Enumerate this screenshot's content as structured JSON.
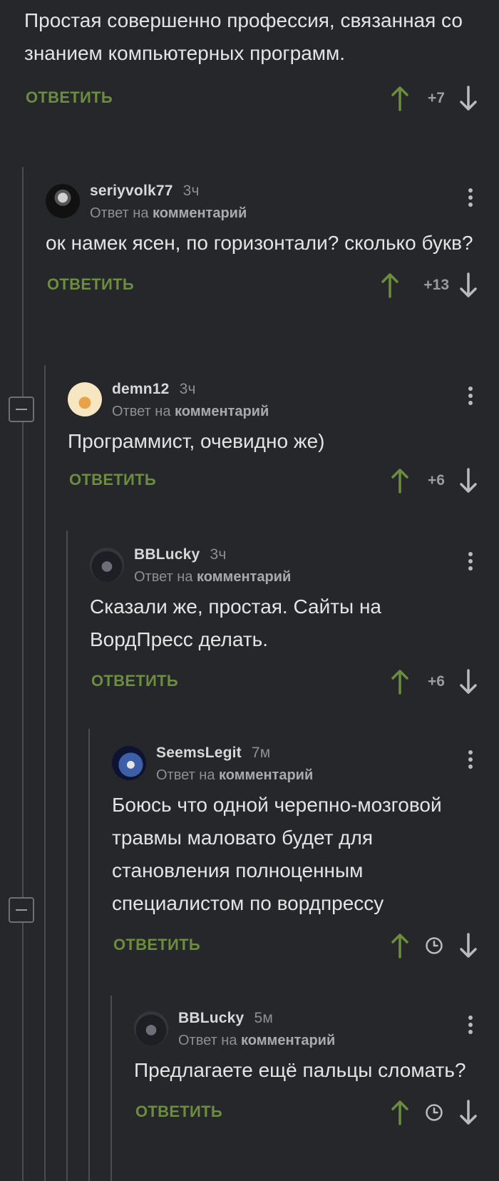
{
  "top": {
    "text": "Простая совершенно профессия, связанная со знанием компьютерных программ.",
    "reply_label": "ОТВЕТИТЬ",
    "rating": "+7"
  },
  "comments": [
    {
      "username": "seriyvolk77",
      "time": "3ч",
      "reply_prefix": "Ответ на",
      "reply_target": "комментарий",
      "text": "ок намек ясен, по горизонтали? сколько букв?",
      "reply_label": "ОТВЕТИТЬ",
      "rating": "+13"
    },
    {
      "username": "demn12",
      "time": "3ч",
      "reply_prefix": "Ответ на",
      "reply_target": "комментарий",
      "text": "Программист, очевидно же)",
      "reply_label": "ОТВЕТИТЬ",
      "rating": "+6"
    },
    {
      "username": "BBLucky",
      "time": "3ч",
      "reply_prefix": "Ответ на",
      "reply_target": "комментарий",
      "text": "Сказали же, простая. Сайты на ВордПресс делать.",
      "reply_label": "ОТВЕТИТЬ",
      "rating": "+6"
    },
    {
      "username": "SeemsLegit",
      "time": "7м",
      "reply_prefix": "Ответ на",
      "reply_target": "комментарий",
      "text": "Боюсь что одной черепно-мозговой травмы маловато будет для становления полноценным специалистом по вордпрессу",
      "reply_label": "ОТВЕТИТЬ",
      "rating": ""
    },
    {
      "username": "BBLucky",
      "time": "5м",
      "reply_prefix": "Ответ на",
      "reply_target": "комментарий",
      "text": "Предлагаете ещё пальцы сломать?",
      "reply_label": "ОТВЕТИТЬ",
      "rating": ""
    }
  ],
  "colors": {
    "background": "#25272a",
    "accent_green": "#6c8d3e",
    "thread_line": "#4a4c4f"
  },
  "icons": {
    "upvote": "arrow-up-icon",
    "downvote": "arrow-down-icon",
    "clock": "clock-icon",
    "more": "kebab-icon",
    "collapse": "minus-icon"
  }
}
